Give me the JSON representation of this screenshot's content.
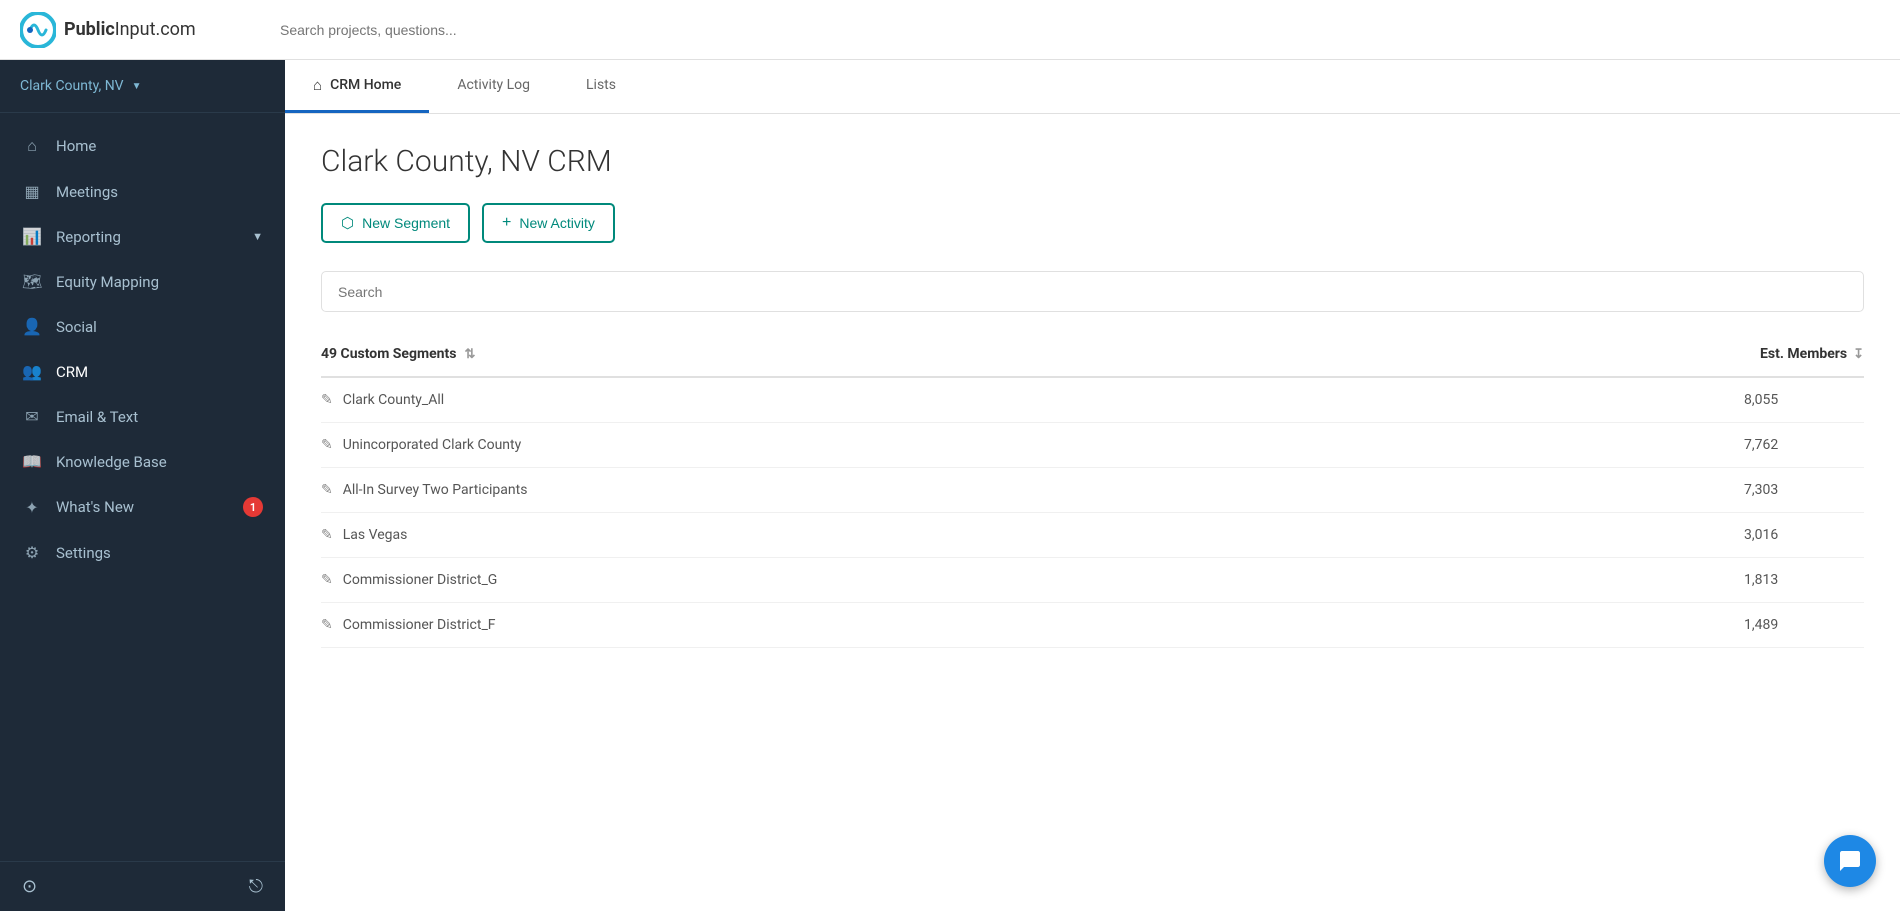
{
  "header": {
    "logo_text_bold": "Public",
    "logo_text_light": "Input.com",
    "search_placeholder": "Search projects, questions..."
  },
  "sidebar": {
    "org_name": "Clark County, NV",
    "items": [
      {
        "id": "home",
        "label": "Home",
        "icon": "⌂",
        "active": false
      },
      {
        "id": "meetings",
        "label": "Meetings",
        "icon": "📅",
        "active": false
      },
      {
        "id": "reporting",
        "label": "Reporting",
        "icon": "📊",
        "active": false,
        "has_chevron": true
      },
      {
        "id": "equity-mapping",
        "label": "Equity Mapping",
        "icon": "🗺",
        "active": false
      },
      {
        "id": "social",
        "label": "Social",
        "icon": "👤",
        "active": false
      },
      {
        "id": "crm",
        "label": "CRM",
        "icon": "👥",
        "active": true
      },
      {
        "id": "email-text",
        "label": "Email & Text",
        "icon": "✉",
        "active": false
      },
      {
        "id": "knowledge-base",
        "label": "Knowledge Base",
        "icon": "📖",
        "active": false
      },
      {
        "id": "whats-new",
        "label": "What's New",
        "icon": "✦",
        "active": false,
        "badge": "1"
      },
      {
        "id": "settings",
        "label": "Settings",
        "icon": "⚙",
        "active": false
      }
    ]
  },
  "tabs": [
    {
      "id": "crm-home",
      "label": "CRM Home",
      "active": true,
      "has_home_icon": true
    },
    {
      "id": "activity-log",
      "label": "Activity Log",
      "active": false
    },
    {
      "id": "lists",
      "label": "Lists",
      "active": false
    }
  ],
  "page": {
    "title": "Clark County, NV CRM",
    "new_segment_label": "New Segment",
    "new_activity_label": "New Activity",
    "search_placeholder": "Search",
    "segments_count_label": "49 Custom Segments",
    "est_members_label": "Est. Members",
    "segments": [
      {
        "name": "Clark County_All",
        "members": "8,055"
      },
      {
        "name": "Unincorporated Clark County",
        "members": "7,762"
      },
      {
        "name": "All-In Survey Two Participants",
        "members": "7,303"
      },
      {
        "name": "Las Vegas",
        "members": "3,016"
      },
      {
        "name": "Commissioner District_G",
        "members": "1,813"
      },
      {
        "name": "Commissioner District_F",
        "members": "1,489"
      }
    ]
  }
}
